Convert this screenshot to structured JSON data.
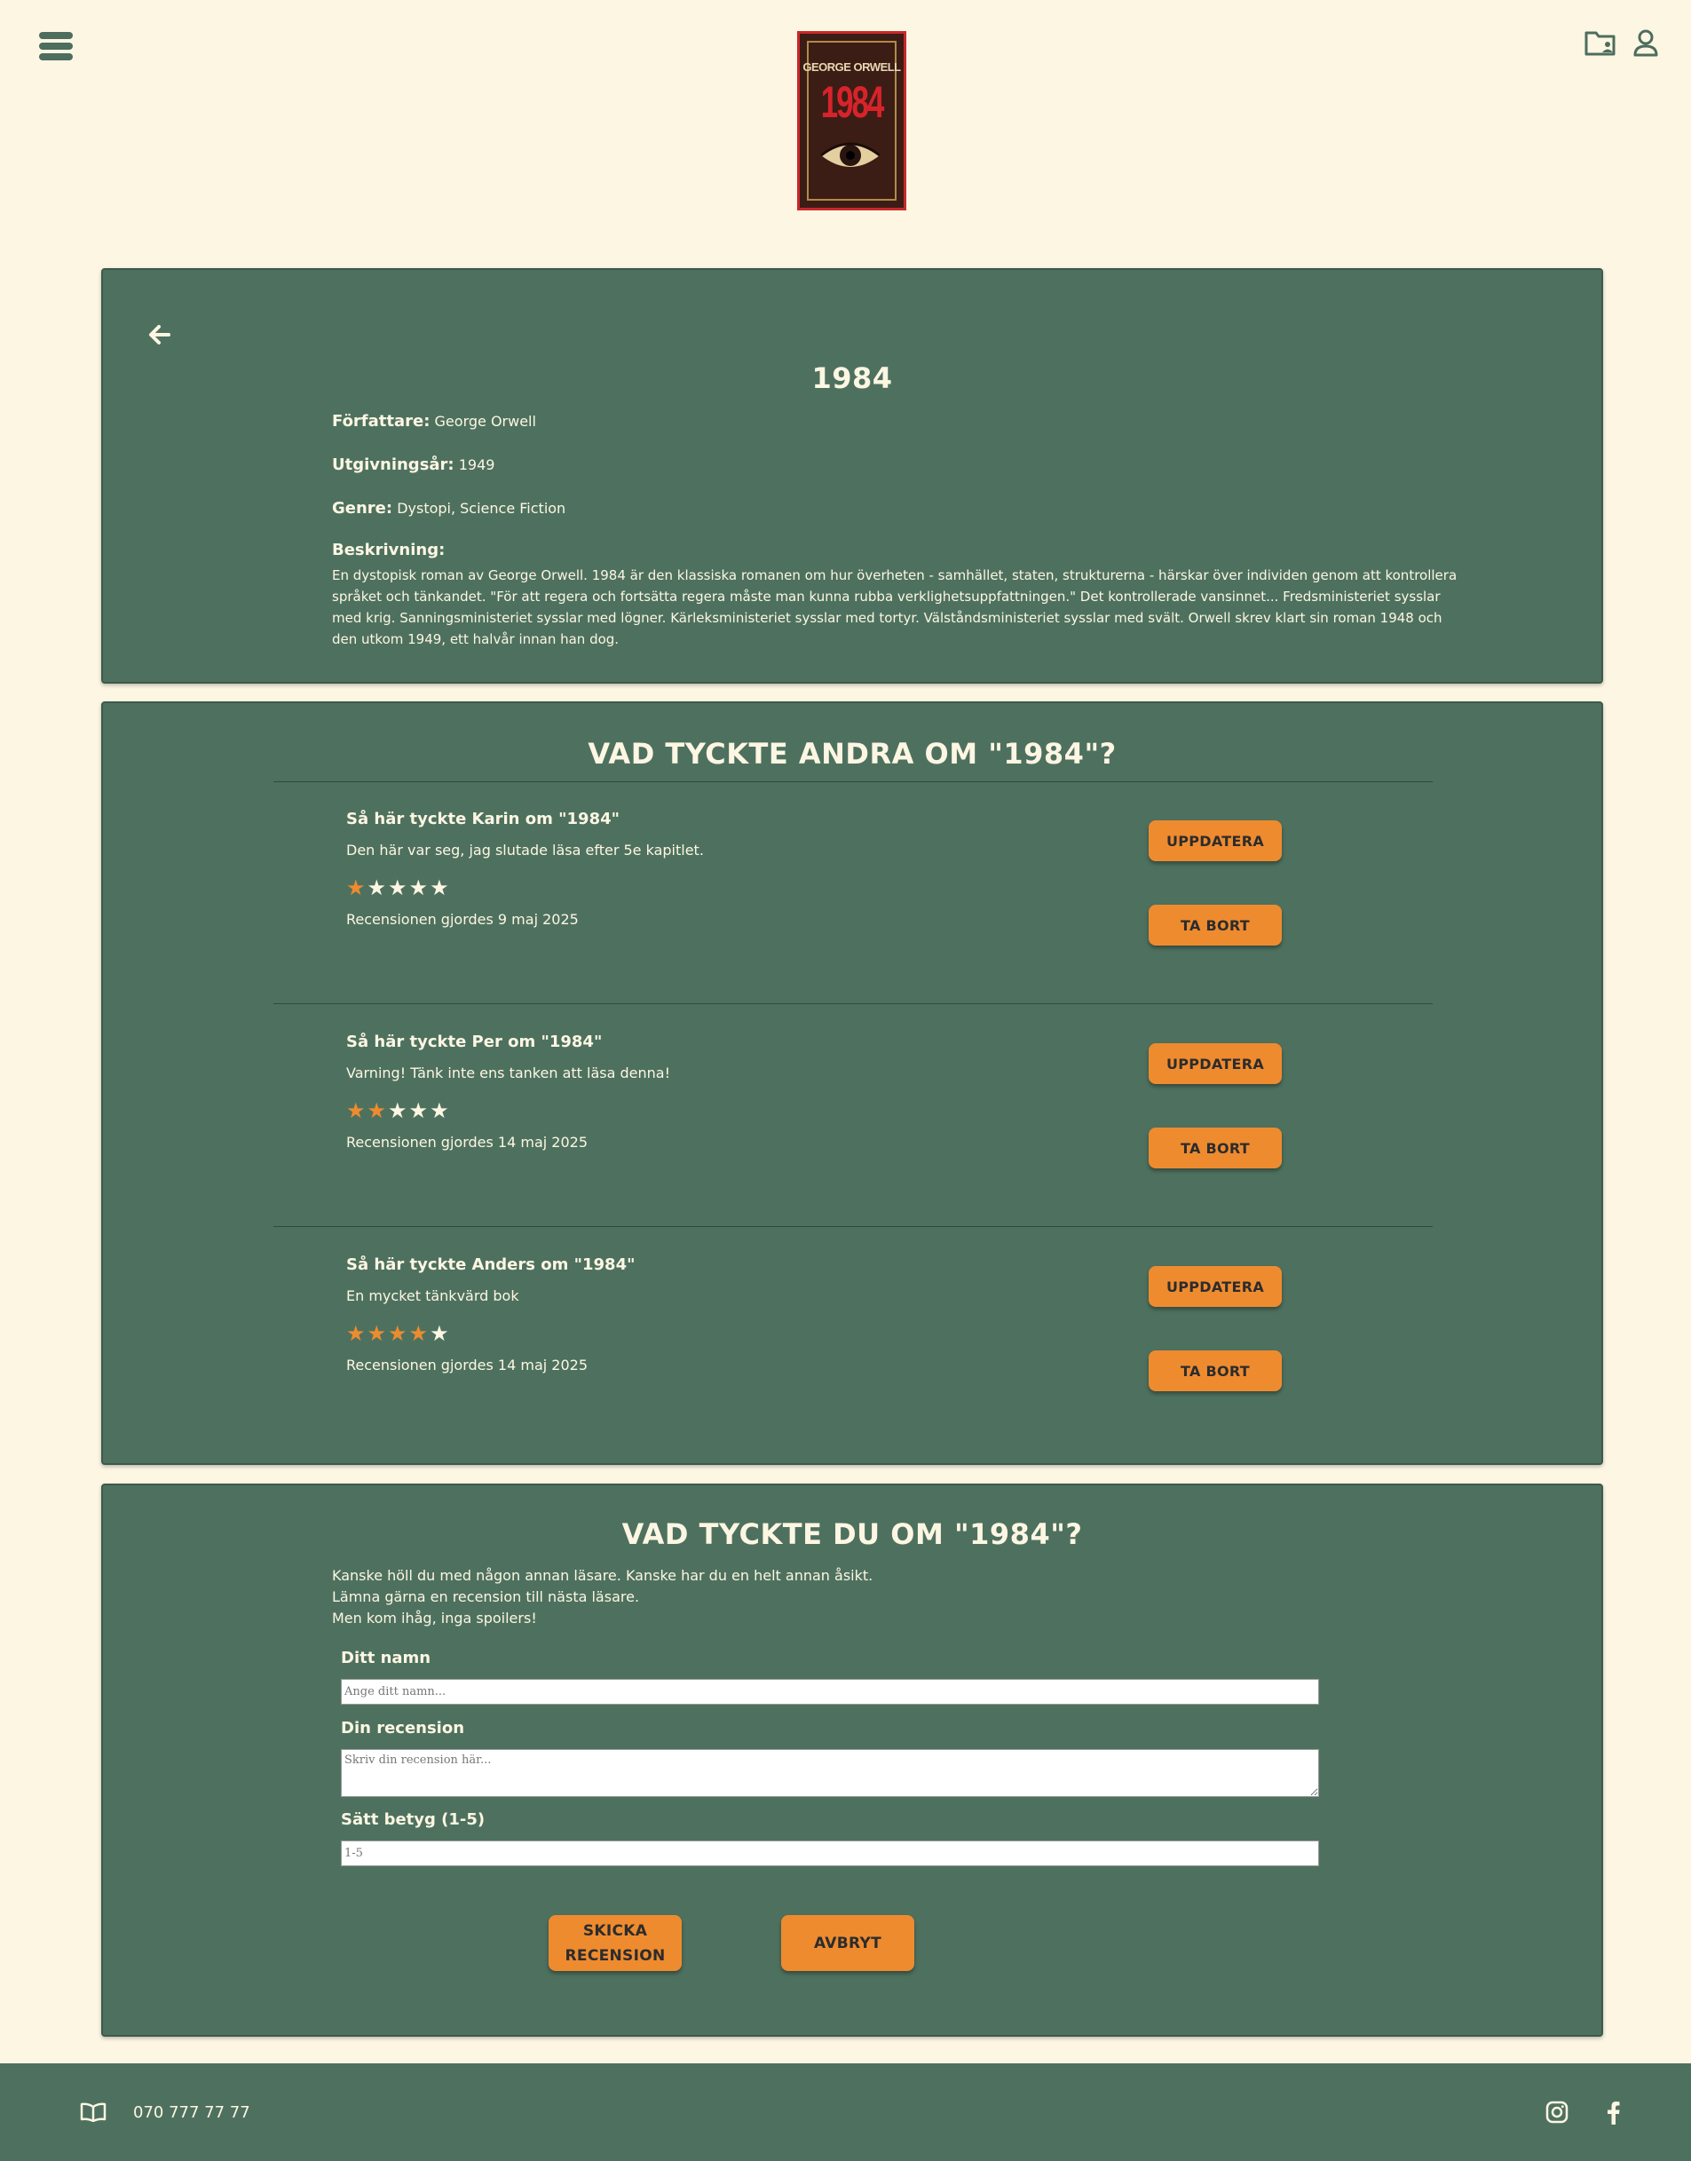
{
  "book": {
    "title": "1984",
    "author_label": "Författare:",
    "author": "George Orwell",
    "year_label": "Utgivningsår:",
    "year": "1949",
    "genre_label": "Genre:",
    "genre": "Dystopi, Science Fiction",
    "description_label": "Beskrivning:",
    "description": "En dystopisk roman av George Orwell. 1984 är den klassiska romanen om hur överheten - samhället, staten, strukturerna - härskar över individen genom att kontrollera språket och tänkandet. \"För att regera och fortsätta regera måste man kunna rubba verklighetsuppfattningen.\" Det kontrollerade vansinnet... Fredsministeriet sysslar med krig. Sanningsministeriet sysslar med lögner. Kärleksministeriet sysslar med tortyr. Välståndsministeriet sysslar med svält. Orwell skrev klart sin roman 1948 och den utkom 1949, ett halvår innan han dog.",
    "cover": {
      "author_text": "GEORGE ORWELL",
      "title_text": "1984"
    }
  },
  "reviews": {
    "title": "Vad tyckte andra om \"1984\"?",
    "update_label": "Uppdatera",
    "delete_label": "Ta bort",
    "items": [
      {
        "title": "Så här tyckte Karin om \"1984\"",
        "text": "Den här var seg, jag slutade läsa efter 5e kapitlet.",
        "rating": 1,
        "date": "Recensionen gjordes 9 maj 2025"
      },
      {
        "title": "Så här tyckte Per om \"1984\"",
        "text": "Varning! Tänk inte ens tanken att läsa denna!",
        "rating": 2,
        "date": "Recensionen gjordes 14 maj 2025"
      },
      {
        "title": "Så här tyckte Anders om \"1984\"",
        "text": "En mycket tänkvärd bok",
        "rating": 4,
        "date": "Recensionen gjordes 14 maj 2025"
      }
    ]
  },
  "form": {
    "title": "Vad tyckte du om \"1984\"?",
    "intro": [
      "Kanske höll du med någon annan läsare. Kanske har du en helt annan åsikt.",
      "Lämna gärna en recension till nästa läsare.",
      "Men kom ihåg, inga spoilers!"
    ],
    "name_label": "Ditt namn",
    "name_placeholder": "Ange ditt namn...",
    "review_label": "Din recension",
    "review_placeholder": "Skriv din recension här...",
    "rating_label": "Sätt betyg (1-5)",
    "rating_placeholder": "1-5",
    "submit_line1": "Skicka",
    "submit_line2": "Recension",
    "cancel_label": "Avbryt"
  },
  "footer": {
    "phone": "070 777 77 77"
  },
  "colors": {
    "background": "#fdf6e3",
    "panel": "#4e715f",
    "accent": "#ee8b2f"
  },
  "icons": [
    "menu-icon",
    "folder-user-icon",
    "user-icon",
    "arrow-left-icon",
    "book-open-icon",
    "instagram-icon",
    "facebook-icon"
  ]
}
